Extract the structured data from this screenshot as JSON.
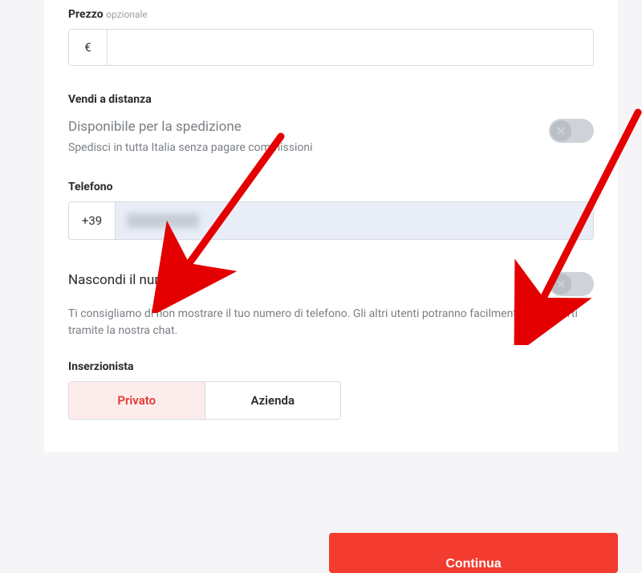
{
  "price": {
    "label": "Prezzo",
    "optional": "opzionale",
    "currency": "€",
    "value": ""
  },
  "remote": {
    "section_title": "Vendi a distanza",
    "shipping_title": "Disponibile per la spedizione",
    "shipping_desc": "Spedisci in tutta Italia senza pagare commissioni"
  },
  "phone": {
    "label": "Telefono",
    "prefix": "+39",
    "value": ""
  },
  "hide_number": {
    "title": "Nascondi il numero",
    "desc": "Ti consigliamo di non mostrare il tuo numero di telefono. Gli altri utenti potranno facilmente contattarti tramite la nostra chat."
  },
  "advertiser": {
    "label": "Inserzionista",
    "options": {
      "private": "Privato",
      "company": "Azienda"
    },
    "selected": "private"
  },
  "footer": {
    "continue": "Continua"
  },
  "colors": {
    "accent": "#f33b2f"
  }
}
